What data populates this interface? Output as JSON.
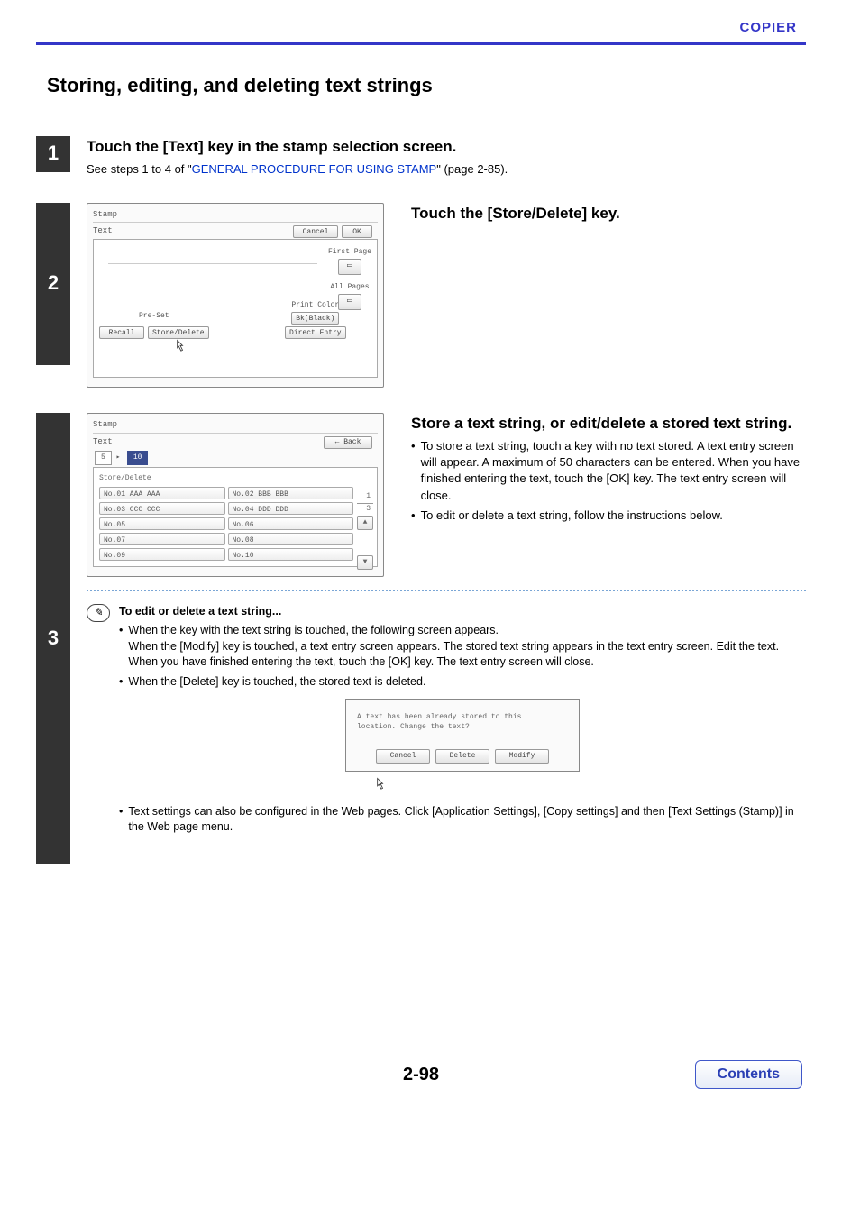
{
  "header": {
    "label": "COPIER"
  },
  "title": "Storing, editing, and deleting text strings",
  "step1": {
    "num": "1",
    "head": "Touch the [Text] key in the stamp selection screen.",
    "sub_a": "See steps 1 to 4 of \"",
    "link": "GENERAL PROCEDURE FOR USING STAMP",
    "sub_b": "\" (page 2-85)."
  },
  "step2": {
    "num": "2",
    "head": "Touch the [Store/Delete] key.",
    "panel": {
      "stamp": "Stamp",
      "text": "Text",
      "cancel": "Cancel",
      "ok": "OK",
      "preset": "Pre-Set",
      "recall": "Recall",
      "store_delete": "Store/Delete",
      "print_color": "Print Color",
      "bk": "Bk(Black)",
      "direct_entry": "Direct Entry",
      "first_page": "First Page",
      "all_pages": "All Pages"
    }
  },
  "step3": {
    "num": "3",
    "head": "Store a text string, or edit/delete a stored text string.",
    "b1": "To store a text string, touch a key with no text stored. A text entry screen will appear. A maximum of 50 characters can be entered. When you have finished entering the text, touch the [OK] key. The text entry screen will close.",
    "b2": "To edit or delete a text string, follow the instructions below.",
    "panel": {
      "stamp": "Stamp",
      "text": "Text",
      "back": "Back",
      "tab5": "5",
      "tab10": "10",
      "sd": "Store/Delete",
      "pg1": "1",
      "pg3": "3",
      "cells": [
        "No.01 AAA AAA",
        "No.02 BBB BBB",
        "No.03 CCC CCC",
        "No.04 DDD DDD",
        "No.05",
        "No.06",
        "No.07",
        "No.08",
        "No.09",
        "No.10"
      ]
    },
    "note": {
      "title": "To edit or delete a text string...",
      "p1": "When the key with the text string is touched, the following screen appears.",
      "p1b": "When the [Modify] key is touched, a text entry screen appears. The stored text string appears in the text entry screen. Edit the text. When you have finished entering the text, touch the [OK] key. The text entry screen will close.",
      "p2": "When the [Delete] key is touched, the stored text is deleted.",
      "dlg_line1": "A text has been already stored to this",
      "dlg_line2": "location. Change the text?",
      "dlg_cancel": "Cancel",
      "dlg_delete": "Delete",
      "dlg_modify": "Modify",
      "p3": "Text settings can also be configured in the Web pages. Click [Application Settings], [Copy settings] and then [Text Settings (Stamp)] in the Web page menu."
    }
  },
  "footer": {
    "page": "2-98",
    "contents": "Contents"
  }
}
